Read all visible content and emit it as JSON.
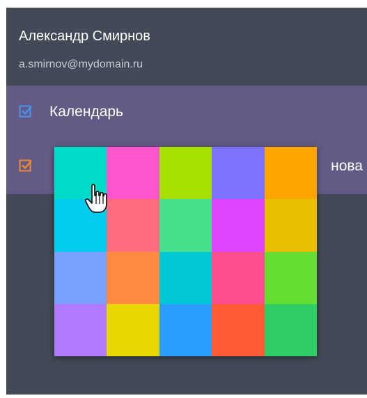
{
  "user": {
    "name": "Александр Смирнов",
    "email": "a.smirnov@mydomain.ru"
  },
  "calendars": [
    {
      "label": "Календарь",
      "checked": true,
      "color": "#4a90f0"
    },
    {
      "label": "нова",
      "checked": true,
      "color": "#f08a30"
    }
  ],
  "colors": {
    "panel_bg": "#414a56",
    "list_bg": "#635b86"
  },
  "palette": [
    "#00dcc8",
    "#ff55cc",
    "#a6e000",
    "#7c74ff",
    "#ffa400",
    "#00cced",
    "#ff6c80",
    "#44e08a",
    "#dd44ff",
    "#e8c000",
    "#7aa0ff",
    "#ff8a40",
    "#00c6d6",
    "#ff4e90",
    "#66dd33",
    "#b07aff",
    "#e6d800",
    "#2a9cff",
    "#ff5a36",
    "#2ecc62"
  ],
  "cursor": "hand-pointer-icon"
}
